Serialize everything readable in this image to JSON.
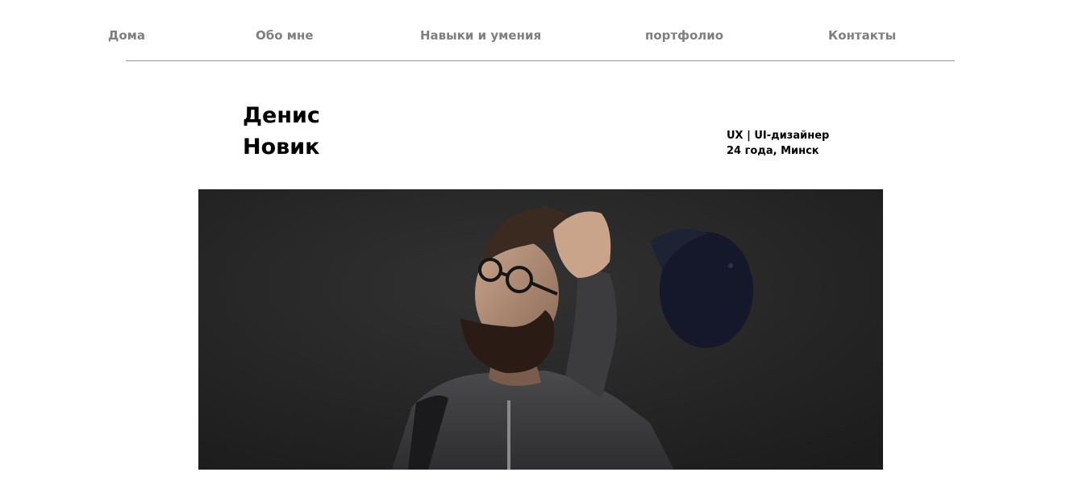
{
  "nav": {
    "items": [
      {
        "label": "Дома"
      },
      {
        "label": "Обо мне"
      },
      {
        "label": "Навыки и умения"
      },
      {
        "label": "портфолио"
      },
      {
        "label": "Контакты"
      }
    ]
  },
  "hero": {
    "first_name": "Денис",
    "last_name": "Новик",
    "role": "UX | UI-дизайнер",
    "age_city": "24 года, Минск"
  },
  "colors": {
    "nav_text": "#7f7f7f",
    "divider": "#9a9a9a",
    "heading": "#000000",
    "photo_background": "#2a2a2a"
  }
}
